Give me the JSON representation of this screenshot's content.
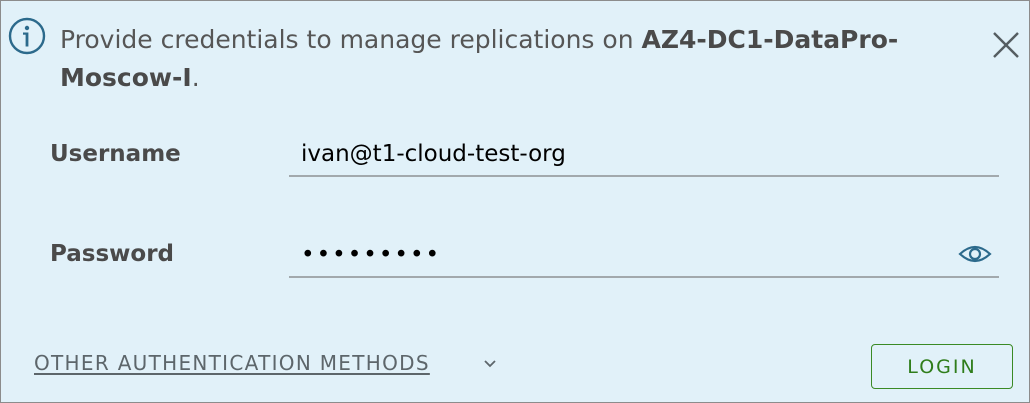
{
  "alert": {
    "icon": "info-icon",
    "message_prefix": "Provide credentials to manage replications on ",
    "site_name": "AZ4-DC1-DataPro-Moscow-I",
    "message_suffix": ".",
    "close_icon": "close-icon"
  },
  "form": {
    "username_label": "Username",
    "username_value": "ivan@t1-cloud-test-org",
    "password_label": "Password",
    "password_value": "•••••••••",
    "password_toggle_icon": "eye-icon"
  },
  "actions": {
    "other_auth_label": "OTHER AUTHENTICATION METHODS",
    "other_auth_icon": "chevron-down-icon",
    "login_label": "LOGIN"
  },
  "colors": {
    "panel_background": "#e1f1f9",
    "info_accent": "#2c6a8c",
    "login_green": "#2f7d1b"
  }
}
